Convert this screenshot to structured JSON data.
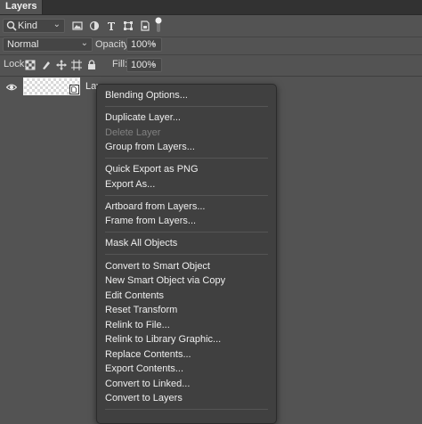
{
  "panel": {
    "title": "Layers"
  },
  "filter": {
    "kind_label": "Kind"
  },
  "blend": {
    "mode": "Normal",
    "opacity_label": "Opacity:",
    "opacity_value": "100%"
  },
  "lock": {
    "label": "Lock:",
    "fill_label": "Fill:",
    "fill_value": "100%"
  },
  "layer": {
    "name": "Lay"
  },
  "context_menu": {
    "items": [
      {
        "label": "Blending Options...",
        "enabled": true
      },
      {
        "label": "Duplicate Layer...",
        "enabled": true
      },
      {
        "label": "Delete Layer",
        "enabled": false
      },
      {
        "label": "Group from Layers...",
        "enabled": true
      },
      {
        "label": "Quick Export as PNG",
        "enabled": true
      },
      {
        "label": "Export As...",
        "enabled": true
      },
      {
        "label": "Artboard from Layers...",
        "enabled": true
      },
      {
        "label": "Frame from Layers...",
        "enabled": true
      },
      {
        "label": "Mask All Objects",
        "enabled": true
      },
      {
        "label": "Convert to Smart Object",
        "enabled": true
      },
      {
        "label": "New Smart Object via Copy",
        "enabled": true
      },
      {
        "label": "Edit Contents",
        "enabled": true
      },
      {
        "label": "Reset Transform",
        "enabled": true
      },
      {
        "label": "Relink to File...",
        "enabled": true
      },
      {
        "label": "Relink to Library Graphic...",
        "enabled": true
      },
      {
        "label": "Replace Contents...",
        "enabled": true
      },
      {
        "label": "Export Contents...",
        "enabled": true
      },
      {
        "label": "Convert to Linked...",
        "enabled": true
      },
      {
        "label": "Convert to Layers",
        "enabled": true
      }
    ]
  }
}
